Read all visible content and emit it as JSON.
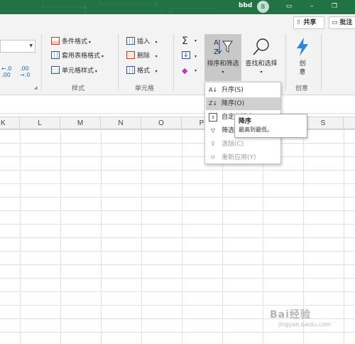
{
  "titlebar": {
    "user_name": "bbd",
    "avatar_initial": "B",
    "accent": "#217346"
  },
  "sharerow": {
    "share_label": "共享",
    "comment_label": "批注"
  },
  "ribbon": {
    "decimal_increase": "←.0\n.00",
    "decimal_decrease": ".00\n→.0",
    "styles": {
      "conditional_format": "条件格式",
      "table_format": "套用表格格式",
      "cell_style": "单元格样式",
      "group_label": "样式"
    },
    "cells": {
      "insert": "插入",
      "delete": "删除",
      "format": "格式",
      "group_label": "单元格"
    },
    "editing": {
      "sort_filter": "排序和筛选",
      "find_select": "查找和选择"
    },
    "ideas": {
      "label": "创意",
      "group_label": "创意"
    }
  },
  "columns": [
    "K",
    "L",
    "M",
    "N",
    "O",
    "P",
    "Q",
    "R",
    "S"
  ],
  "sort_menu": {
    "items": [
      {
        "label": "升序(S)",
        "icon": "sort-asc-icon",
        "highlighted": false,
        "disabled": false
      },
      {
        "label": "降序(O)",
        "icon": "sort-desc-icon",
        "highlighted": true,
        "disabled": false
      },
      {
        "label": "自定义排序(U)...",
        "icon": "custom-sort-icon",
        "highlighted": false,
        "disabled": false
      },
      {
        "label": "筛选(F)",
        "icon": "filter-icon",
        "highlighted": false,
        "disabled": false
      },
      {
        "label": "清除(C)",
        "icon": "clear-filter-icon",
        "highlighted": false,
        "disabled": true
      },
      {
        "label": "重新应用(Y)",
        "icon": "reapply-icon",
        "highlighted": false,
        "disabled": true
      }
    ]
  },
  "tooltip": {
    "title": "降序",
    "description": "最高到最低。"
  },
  "watermark": {
    "line1": "Bai经验",
    "line2": "jingyan.baidu.com"
  }
}
